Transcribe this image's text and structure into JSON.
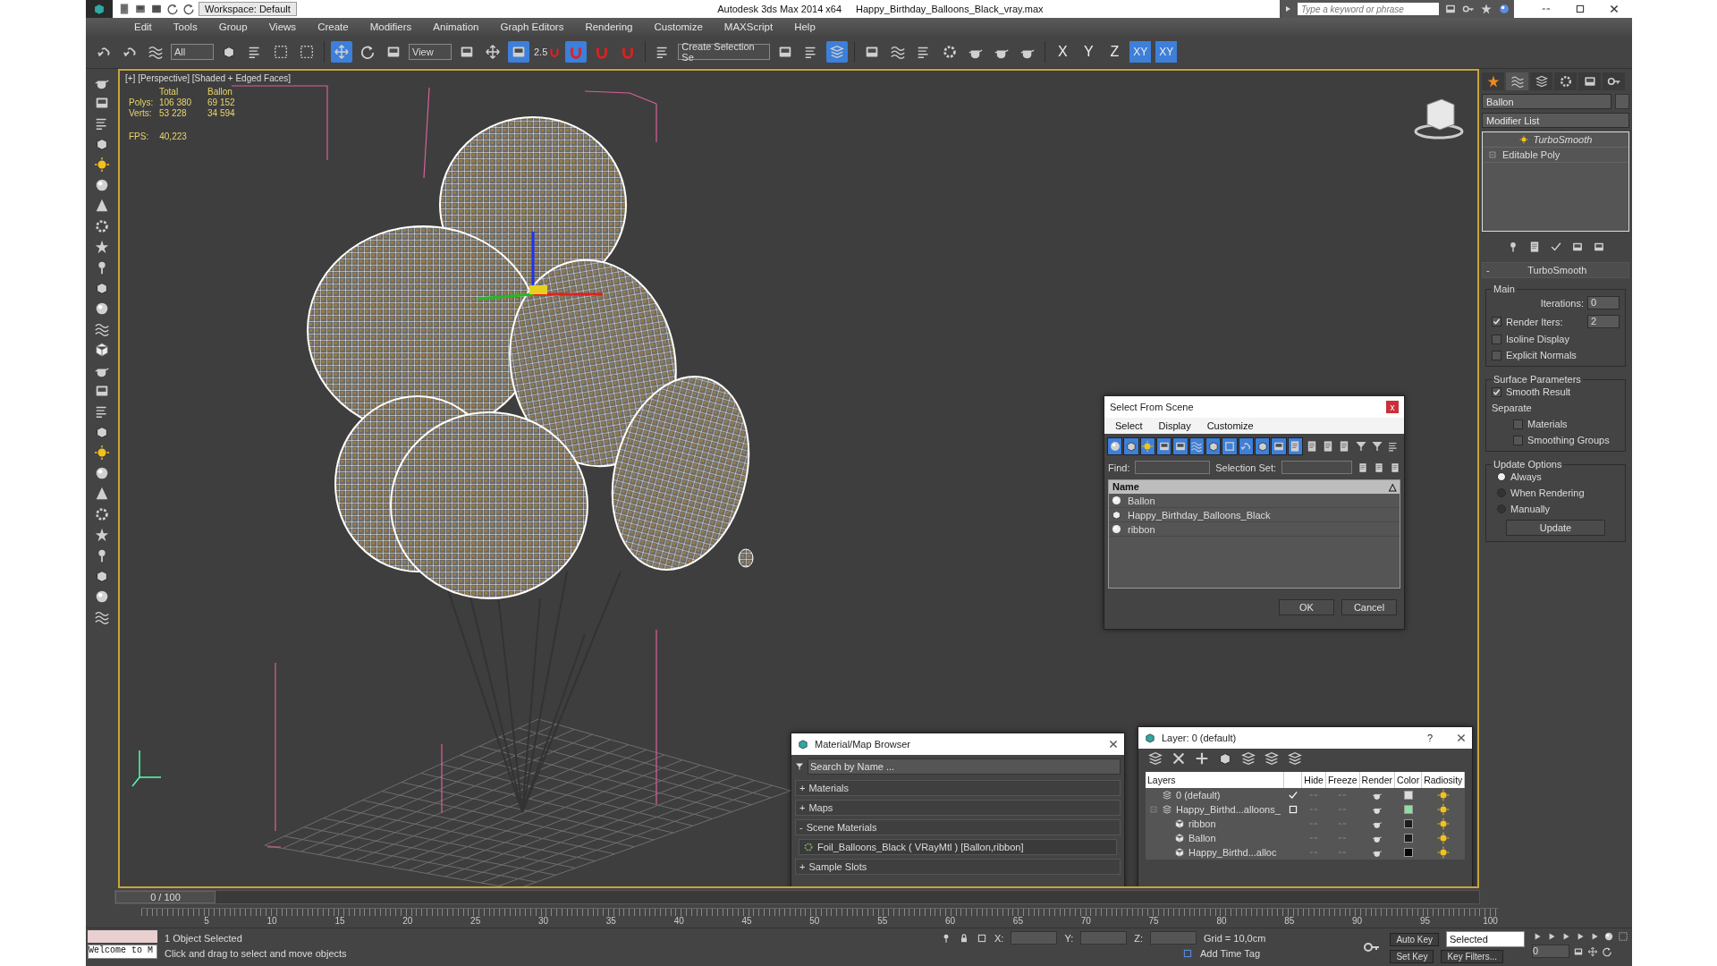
{
  "title_bar": {
    "workspace": "Workspace: Default",
    "app_title": "Autodesk 3ds Max  2014 x64",
    "file_name": "Happy_Birthday_Balloons_Black_vray.max",
    "search": {
      "placeholder": "Type a keyword or phrase"
    }
  },
  "menu": [
    "Edit",
    "Tools",
    "Group",
    "Views",
    "Create",
    "Modifiers",
    "Animation",
    "Graph Editors",
    "Rendering",
    "Customize",
    "MAXScript",
    "Help"
  ],
  "toolbar": {
    "selection_filter": "All",
    "reference_coordinate": "View",
    "snap_value": "2.5",
    "named_selection": "Create Selection Se",
    "axes": [
      {
        "label": "X",
        "selected": false
      },
      {
        "label": "Y",
        "selected": false
      },
      {
        "label": "Z",
        "selected": false
      },
      {
        "label": "XY",
        "selected": true
      },
      {
        "label": "XY",
        "selected": true
      }
    ]
  },
  "viewport": {
    "label": "[+] [Perspective] [Shaded + Edged Faces]",
    "stats_headers": [
      "Total",
      "Ballon"
    ],
    "stats": [
      {
        "label": "Polys:",
        "total": "106 380",
        "selected": "69 152"
      },
      {
        "label": "Verts:",
        "total": "53 228",
        "selected": "34 594"
      }
    ],
    "fps_label": "FPS:",
    "fps": "40,223"
  },
  "command_panel": {
    "object_name": "Ballon",
    "modifier_list": "Modifier List",
    "stack": [
      "TurboSmooth",
      "Editable Poly"
    ],
    "rollout": {
      "title": "TurboSmooth",
      "toggle": "-",
      "main": {
        "title": "Main",
        "iterations_label": "Iterations:",
        "iterations": "0",
        "render_iters": {
          "label": "Render Iters:",
          "checked": true,
          "value": "2"
        },
        "options": [
          {
            "label": "Isoline Display",
            "checked": false
          },
          {
            "label": "Explicit Normals",
            "checked": false
          }
        ]
      },
      "surface": {
        "title": "Surface Parameters",
        "smooth_result": {
          "label": "Smooth Result",
          "checked": true
        },
        "separate_label": "Separate",
        "separate": [
          {
            "label": "Materials",
            "checked": false
          },
          {
            "label": "Smoothing Groups",
            "checked": false
          }
        ]
      },
      "update": {
        "title": "Update Options",
        "options": [
          {
            "label": "Always",
            "selected": true
          },
          {
            "label": "When Rendering",
            "selected": false
          },
          {
            "label": "Manually",
            "selected": false
          }
        ],
        "button": "Update"
      }
    }
  },
  "select_dialog": {
    "title": "Select From Scene",
    "close": "x",
    "menu": [
      "Select",
      "Display",
      "Customize"
    ],
    "find_label": "Find:",
    "selection_set_label": "Selection Set:",
    "column": "Name",
    "sort_mark": "△",
    "rows": [
      {
        "name": "Ballon",
        "kind": "geometry"
      },
      {
        "name": "Happy_Birthday_Balloons_Black",
        "kind": "group"
      },
      {
        "name": "ribbon",
        "kind": "geometry"
      }
    ],
    "buttons": [
      "OK",
      "Cancel"
    ]
  },
  "material_browser": {
    "title": "Material/Map Browser",
    "search": {
      "placeholder": "Search by Name ..."
    },
    "groups": [
      {
        "toggle": "+",
        "label": "Materials"
      },
      {
        "toggle": "+",
        "label": "Maps"
      },
      {
        "toggle": "-",
        "label": "Scene Materials",
        "items": [
          "Foil_Balloons_Black ( VRayMtl ) [Ballon,ribbon]"
        ]
      },
      {
        "toggle": "+",
        "label": "Sample Slots"
      }
    ]
  },
  "layer_dialog": {
    "title": "Layer: 0 (default)",
    "help": "?",
    "columns": [
      "Layers",
      "Hide",
      "Freeze",
      "Render",
      "Color",
      "Radiosity"
    ],
    "layers": [
      {
        "name": "0 (default)",
        "kind": "layer",
        "current": true,
        "color": "#dcdcdc"
      },
      {
        "name": "Happy_Birthd...alloons_",
        "kind": "layer",
        "current": false,
        "color": "#8de0a0",
        "children": [
          {
            "name": "ribbon",
            "kind": "object",
            "color": "#1c1c1c"
          },
          {
            "name": "Ballon",
            "kind": "object",
            "color": "#1c1c1c"
          },
          {
            "name": "Happy_Birthd...alloc",
            "kind": "object",
            "color": "#050505"
          }
        ]
      }
    ]
  },
  "timeline": {
    "frame": "0 / 100",
    "ticks": [
      "5",
      "10",
      "15",
      "20",
      "25",
      "30",
      "35",
      "40",
      "45",
      "50",
      "55",
      "60",
      "65",
      "70",
      "75",
      "80",
      "85",
      "90",
      "95",
      "100"
    ]
  },
  "status_bar": {
    "listener": "Welcome to M",
    "selection": "1 Object Selected",
    "prompt": "Click and drag to select and move objects",
    "x_label": "X:",
    "y_label": "Y:",
    "z_label": "Z:",
    "grid": "Grid = 10,0cm",
    "add_time_tag": "Add Time Tag",
    "auto_key": "Auto Key",
    "set_key": "Set Key",
    "key_mode": "Selected",
    "key_filters": "Key Filters...",
    "current_frame": "0"
  }
}
